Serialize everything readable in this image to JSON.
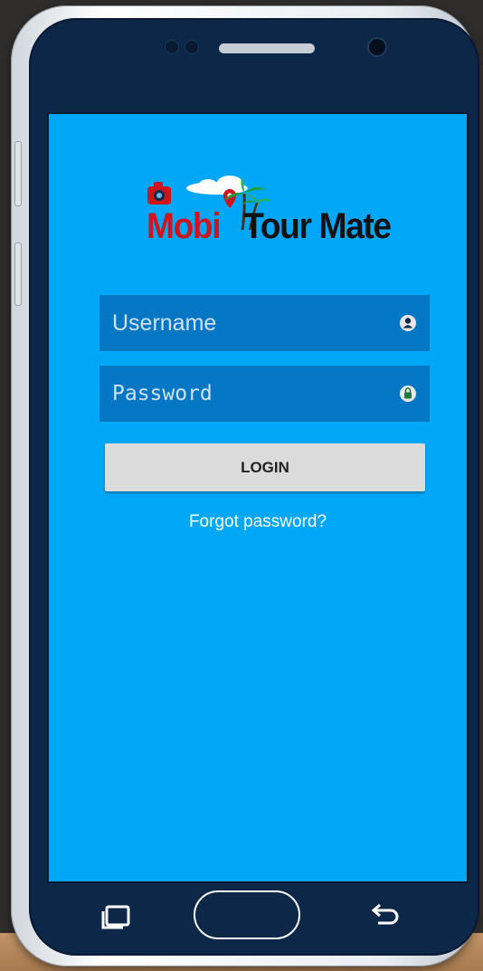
{
  "app": {
    "logo_text_red": "Mobi",
    "logo_text_black": "Tour Mate"
  },
  "login_form": {
    "username_placeholder": "Username",
    "password_placeholder": "Password",
    "login_label": "LOGIN",
    "forgot_label": "Forgot password?"
  },
  "icons": {
    "username": "user-icon",
    "password": "lock-icon",
    "logo": "camera-palm-cloud-pin-icon",
    "nav_recent": "recent-apps-icon",
    "nav_home": "home-button",
    "nav_back": "back-icon"
  },
  "colors": {
    "screen_background": "#00a7f6",
    "input_background": "#0377c4",
    "button_background": "#dbdbdb",
    "logo_red": "#d0141e",
    "phone_body": "#0c2747"
  }
}
